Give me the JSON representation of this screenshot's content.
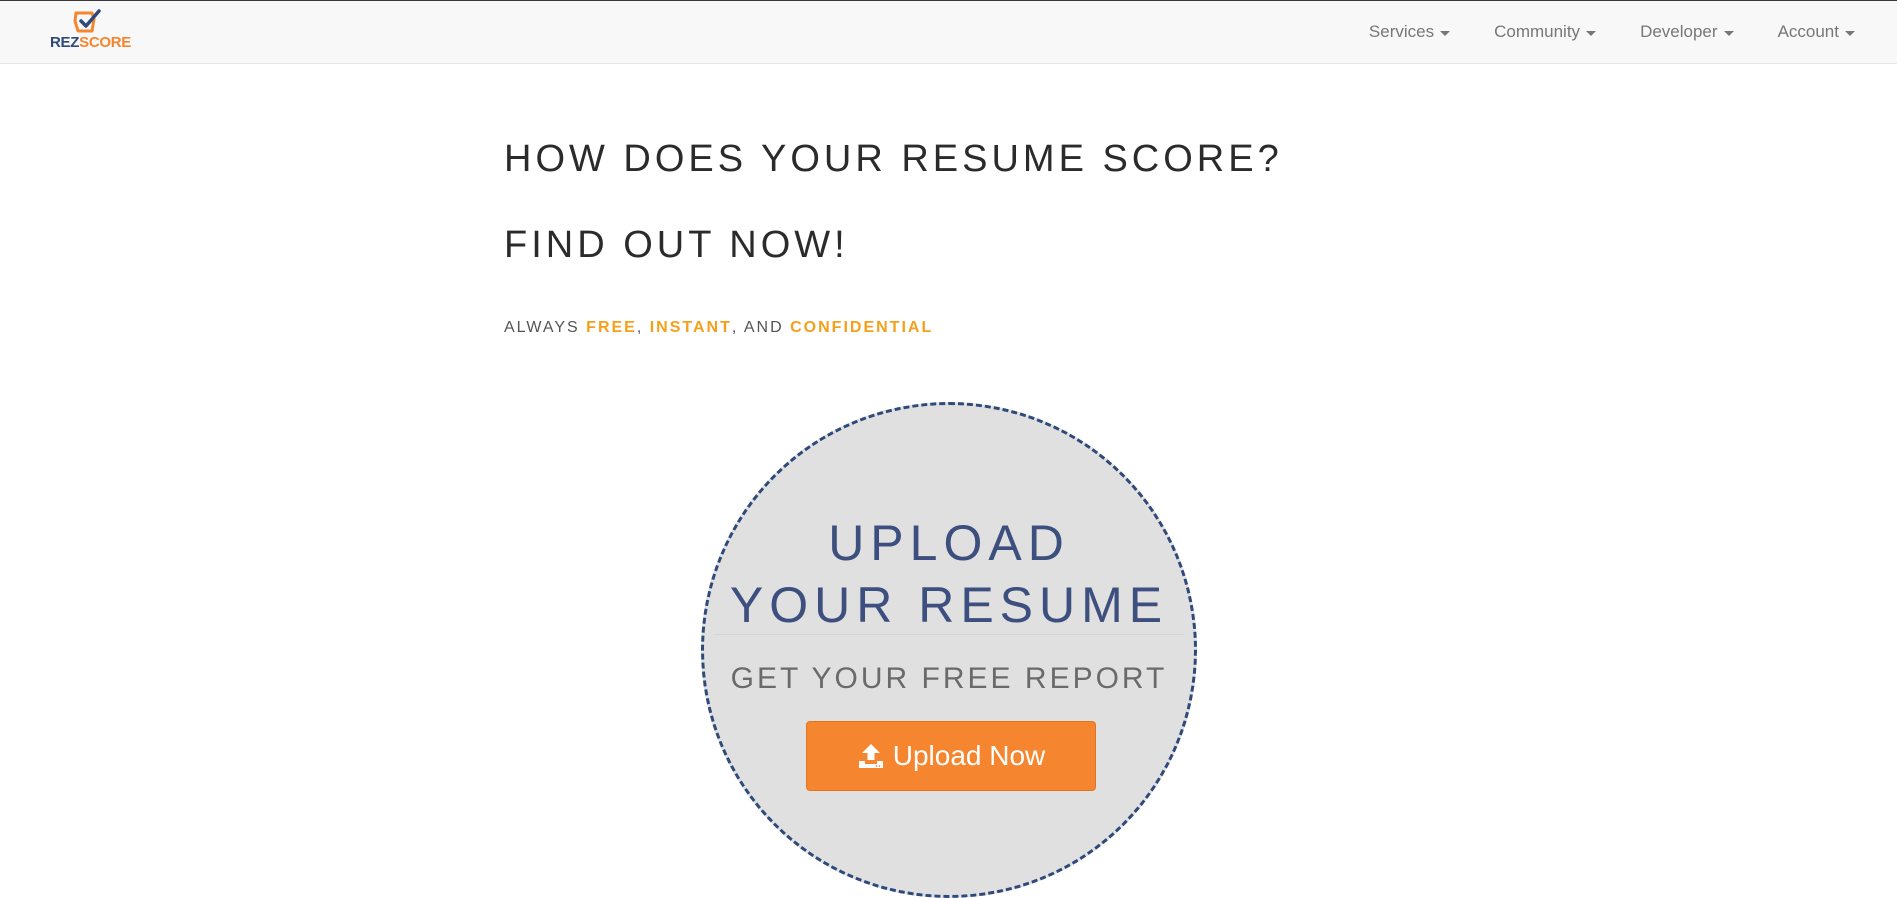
{
  "brand": {
    "name_part1": "REZ",
    "name_part2": "SCORE",
    "icon": "checkmark-box-icon",
    "colors": {
      "primary": "#2f4a7a",
      "accent": "#f5862f"
    }
  },
  "nav": {
    "items": [
      {
        "label": "Services"
      },
      {
        "label": "Community"
      },
      {
        "label": "Developer"
      },
      {
        "label": "Account"
      }
    ]
  },
  "hero": {
    "headline_1": "HOW DOES YOUR RESUME SCORE?",
    "headline_2": "FIND OUT NOW!",
    "tagline": {
      "prefix": "ALWAYS ",
      "word_1": "FREE",
      "sep_1": ", ",
      "word_2": "INSTANT",
      "sep_2": ", AND ",
      "word_3": "CONFIDENTIAL",
      "highlight_color": "#f5a01a"
    }
  },
  "upload": {
    "title_line_1": "UPLOAD",
    "title_line_2": "YOUR RESUME",
    "subtitle": "GET YOUR FREE REPORT",
    "button_label": "Upload Now",
    "button_icon": "upload-icon",
    "button_color": "#f5862f"
  }
}
